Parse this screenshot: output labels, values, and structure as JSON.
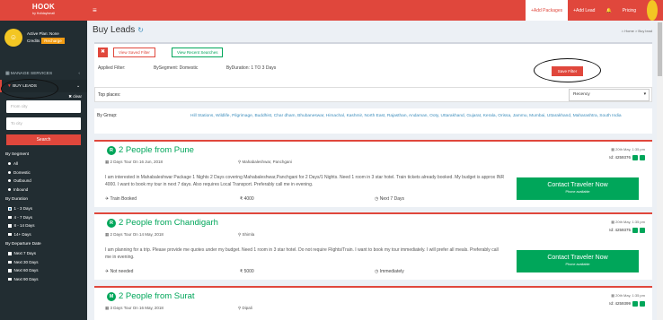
{
  "app": {
    "logo_title": "HOOK",
    "logo_sub": "by Holidayhmall"
  },
  "user": {
    "plan_label": "Active Plan: None",
    "credits_label": "Credits",
    "recharge_label": "Recharge"
  },
  "sidebar": {
    "menu": [
      {
        "label": "MANAGE SERVICES"
      },
      {
        "label": "BUY LEADS"
      }
    ],
    "clear_label": "clear",
    "from_city_placeholder": "From city",
    "to_city_placeholder": "To city",
    "search_label": "Search",
    "segment": {
      "title": "By Segment",
      "options": [
        "All",
        "Domestic",
        "Outbound",
        "Inbound"
      ]
    },
    "duration": {
      "title": "By Duration",
      "options": [
        "1 - 3 Days",
        "4 - 7 Days",
        "8 - 14 Days",
        "14+ Days"
      ]
    },
    "departure": {
      "title": "By Departure Date",
      "options": [
        "Next 7 Days",
        "Next 30 Days",
        "Next 60 Days",
        "Next 90 Days"
      ]
    }
  },
  "topbar": {
    "add_packages": "+Add Packages",
    "add_lead": "+Add Lead",
    "pricing": "Pricing"
  },
  "page": {
    "title": "Buy Leads",
    "breadcrumb": "Home > Buy lead"
  },
  "filters": {
    "view_all_label": "View Saved Filter",
    "view_recent_label": "View Recent Searches",
    "applied_label": "Applied Filter:",
    "segment_text": "BySegment: Domestic",
    "duration_text": "ByDuration: 1 TO 3 Days",
    "save_label": "Save Filter"
  },
  "plan_row": {
    "label": "Top places:",
    "select_value": "Recency"
  },
  "group_row": {
    "label": "By Group:",
    "text": "Hill Stations, Wildlife, Pilgrimage, Buddhist, Char dham, Bhubaneswar, Himachal, Kashmir, North East, Rajasthan, Andaman, Ooty, Uttarakhand, Gujarat, Kerala, Orissa, Jammu, Mumbai, Uttarakhand, Maharashtra, South India"
  },
  "leads": [
    {
      "initial": "R",
      "title": "2 People from Pune",
      "date": "20th May, 1:35 pm",
      "id": "Id: 4259376",
      "tour": "2 Days Tour On 16 Jun, 2018",
      "destination": "Mahabaleshwar, Panchgani",
      "description": "I am interested in Mahabaleshwar Package 1 Nights 2 Days covering Mahabaleshwar,Panchgani for 2 Days/1 Nights. Need 1 room in 3 star hotel. Train tickets already booked. My budget is approx INR 4000. I want to book my tour in next 7 days. Also requires Local Transport. Preferably call me in evening.",
      "transport": "Train Booked",
      "budget": "4000",
      "timing": "Next 7 Days",
      "contact_label": "Contact Traveler Now",
      "contact_sub": "Phone available"
    },
    {
      "initial": "R",
      "title": "2 People from Chandigarh",
      "date": "20th May, 1:35 pm",
      "id": "Id: 4259375",
      "tour": "2 Days Tour On 14 May, 2018",
      "destination": "Shimla",
      "description": "I am planning for a trip. Please provide me quotes under my budget. Need 1 room in 3 star hotel. Do not require Flights/Train. I want to book my tour immediately. I will prefer all meals. Preferably call me in evening.",
      "transport": "Not needed",
      "budget": "5000",
      "timing": "Immediately",
      "contact_label": "Contact Traveler Now",
      "contact_sub": "Phone available"
    },
    {
      "initial": "M",
      "title": "2 People from Surat",
      "date": "20th May, 1:35 pm",
      "id": "Id: 4259399",
      "tour": "3 Days Tour On 16 May, 2018",
      "destination": "Dipali"
    }
  ],
  "colors": {
    "brand": "#e0473c",
    "sidebar": "#222d32",
    "green": "#00a65a",
    "link": "#3c8dbc"
  }
}
